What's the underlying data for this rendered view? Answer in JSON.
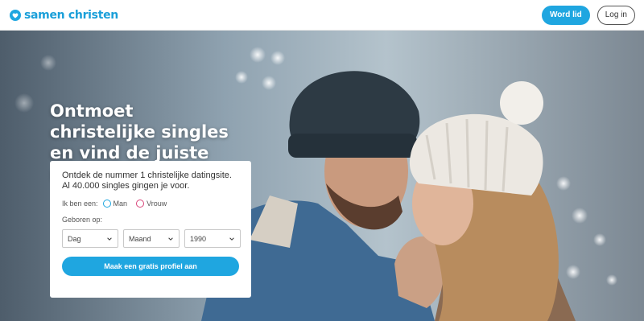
{
  "header": {
    "logo_text": "samen christen",
    "join_label": "Word lid",
    "login_label": "Log in"
  },
  "hero": {
    "title": "Ontmoet christelijke singles en vind de juiste match",
    "image": "couple-in-winter-hats-smiling"
  },
  "form": {
    "intro": "Ontdek de nummer 1 christelijke datingsite. Al 40.000 singles gingen je voor.",
    "gender_label": "Ik ben een:",
    "gender_options": [
      "Man",
      "Vrouw"
    ],
    "dob_label": "Geboren op:",
    "day": "Dag",
    "month": "Maand",
    "year": "1990",
    "cta_label": "Maak een gratis profiel aan"
  },
  "colors": {
    "brand": "#1fa6e0",
    "female": "#d9457a"
  },
  "icons": [
    "heart-logo-icon",
    "chevron-down-icon"
  ]
}
